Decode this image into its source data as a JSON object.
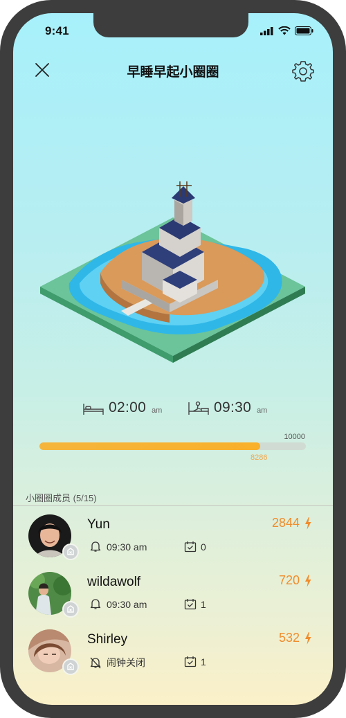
{
  "status": {
    "time": "9:41"
  },
  "header": {
    "title": "早睡早起小圈圈"
  },
  "schedule": {
    "sleep_time": "02:00",
    "sleep_unit": "am",
    "wake_time": "09:30",
    "wake_unit": "am"
  },
  "progress": {
    "goal": "10000",
    "current": "8286",
    "fraction": 0.8286
  },
  "members": {
    "header": "小圈圈成员 (5/15)",
    "list": [
      {
        "name": "Yun",
        "alarm": "09:30 am",
        "alarm_on": true,
        "checkins": "0",
        "score": "2844"
      },
      {
        "name": "wildawolf",
        "alarm": "09:30 am",
        "alarm_on": true,
        "checkins": "1",
        "score": "720"
      },
      {
        "name": "Shirley",
        "alarm": "闹钟关闭",
        "alarm_on": false,
        "checkins": "1",
        "score": "532"
      }
    ]
  },
  "colors": {
    "accent": "#f08c2c",
    "bar": "#f5b53c",
    "track": "#d0dbd3"
  }
}
